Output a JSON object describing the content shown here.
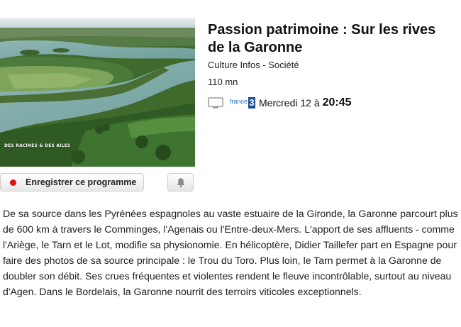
{
  "program": {
    "title": "Passion patrimoine : Sur les rives de la Garonne",
    "category": "Culture Infos - Société",
    "duration": "110 mn",
    "thumbnail_watermark": "DES RACINES & DES AILES"
  },
  "broadcast": {
    "channel_name": "france",
    "channel_number": "3",
    "date": "Mercredi 12 à",
    "time": "20:45"
  },
  "actions": {
    "record_label": "Enregistrer ce programme",
    "reminder_icon": "bell-icon"
  },
  "description": "De sa source dans les Pyrénées espagnoles au vaste estuaire de la Gironde, la Garonne parcourt plus de 600 km à travers le Comminges, l'Agenais ou l'Entre-deux-Mers. L'apport de ses affluents - comme l'Ariège, le Tarn et le Lot, modifie sa physionomie. En hélicoptère, Didier Taillefer part en Espagne pour faire des photos de sa source principale : le Trou du Toro. Plus loin, le Tarn permet à la Garonne de doubler son débit. Ses crues fréquentes et violentes rendent le fleuve incontrôlable, surtout au niveau d'Agen. Dans le Bordelais, la Garonne nourrit des terroirs viticoles exceptionnels.",
  "colors": {
    "record_dot": "#e01414",
    "channel_blue": "#1a4f98"
  }
}
